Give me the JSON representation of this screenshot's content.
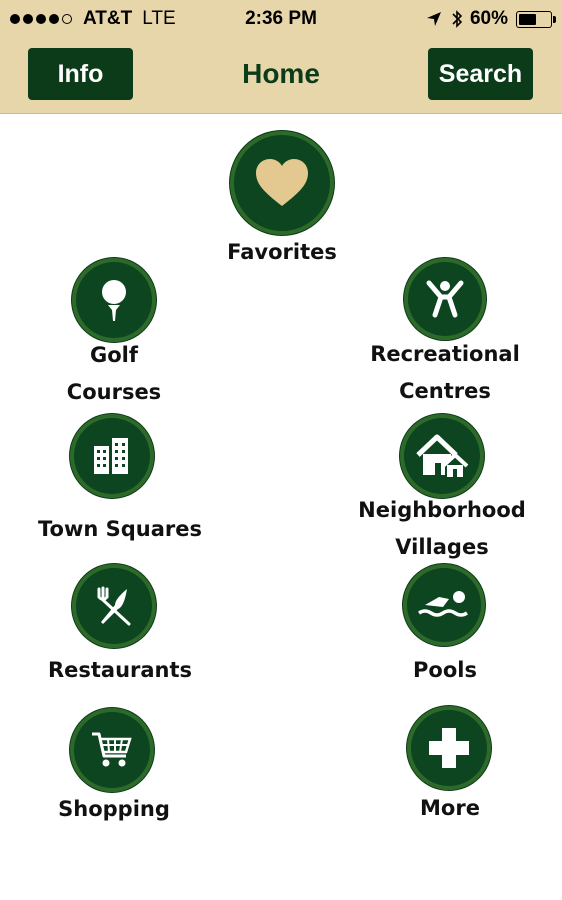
{
  "status_bar": {
    "carrier": "AT&T",
    "network": "LTE",
    "time": "2:36 PM",
    "battery": "60%",
    "battery_level": 0.6
  },
  "nav": {
    "info_label": "Info",
    "title": "Home",
    "search_label": "Search"
  },
  "menu": {
    "favorites": "Favorites",
    "golf": "Golf\nCourses",
    "recreational": "Recreational\nCentres",
    "town_squares": "Town Squares",
    "neighborhood": "Neighborhood\nVillages",
    "restaurants": "Restaurants",
    "pools": "Pools",
    "shopping": "Shopping",
    "more": "More"
  },
  "colors": {
    "header_bg": "#e8d6ab",
    "brand_green": "#0c3b19",
    "heart": "#e3c98f"
  },
  "icons": [
    "heart-icon",
    "golf-ball-icon",
    "person-jumping-icon",
    "buildings-icon",
    "houses-icon",
    "fork-knife-icon",
    "swimmer-icon",
    "shopping-cart-icon",
    "plus-icon",
    "signal-dots-icon",
    "location-arrow-icon",
    "bluetooth-icon",
    "battery-icon"
  ]
}
